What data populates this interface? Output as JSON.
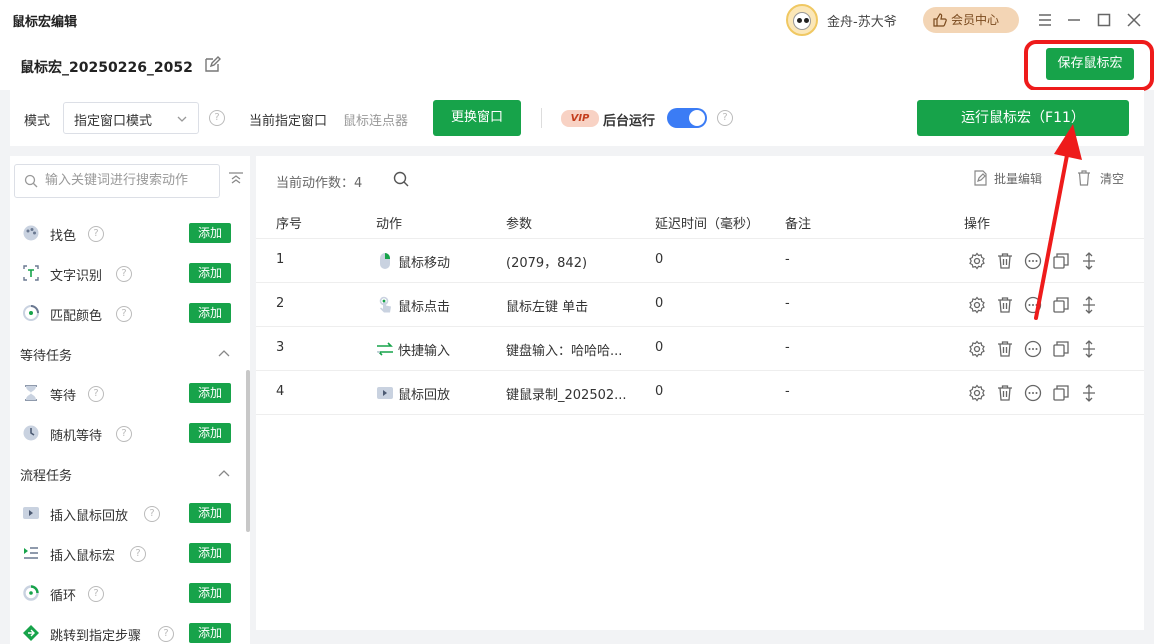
{
  "window": {
    "title": "鼠标宏编辑",
    "user_name": "金舟-苏大爷",
    "member_center": "会员中心"
  },
  "header": {
    "macro_name": "鼠标宏_20250226_2052",
    "save_label": "保存鼠标宏"
  },
  "mode_bar": {
    "mode_label": "模式",
    "mode_value": "指定窗口模式",
    "current_window_label": "当前指定窗口",
    "current_window_value": "鼠标连点器",
    "change_window": "更换窗口",
    "vip": "VIP",
    "background_run": "后台运行",
    "background_run_on": true,
    "run_label": "运行鼠标宏（F11）"
  },
  "sidebar": {
    "search_placeholder": "输入关键词进行搜索动作",
    "add_label": "添加",
    "items_top": [
      {
        "label": "找色",
        "icon": "palette-icon"
      },
      {
        "label": "文字识别",
        "icon": "text-recognition-icon"
      },
      {
        "label": "匹配颜色",
        "icon": "color-match-icon"
      }
    ],
    "sections": [
      {
        "title": "等待任务",
        "items": [
          {
            "label": "等待",
            "icon": "hourglass-icon"
          },
          {
            "label": "随机等待",
            "icon": "clock-icon"
          }
        ]
      },
      {
        "title": "流程任务",
        "items": [
          {
            "label": "插入鼠标回放",
            "icon": "playback-icon"
          },
          {
            "label": "插入鼠标宏",
            "icon": "macro-list-icon"
          },
          {
            "label": "循环",
            "icon": "loop-icon"
          },
          {
            "label": "跳转到指定步骤",
            "icon": "jump-icon"
          }
        ]
      }
    ]
  },
  "main": {
    "count_label": "当前动作数：4",
    "batch_edit": "批量编辑",
    "clear": "清空",
    "columns": [
      "序号",
      "动作",
      "参数",
      "延迟时间（毫秒）",
      "备注",
      "操作"
    ],
    "rows": [
      {
        "index": "1",
        "action": "鼠标移动",
        "icon": "mouse-icon",
        "params": "(2079，842)",
        "delay": "0",
        "note": "-"
      },
      {
        "index": "2",
        "action": "鼠标点击",
        "icon": "click-icon",
        "params": "鼠标左键 单击",
        "delay": "0",
        "note": "-"
      },
      {
        "index": "3",
        "action": "快捷输入",
        "icon": "quick-input-icon",
        "params": "键盘输入：哈哈哈...",
        "delay": "0",
        "note": "-"
      },
      {
        "index": "4",
        "action": "鼠标回放",
        "icon": "playback-icon",
        "params": "键鼠录制_202502...",
        "delay": "0",
        "note": "-"
      }
    ]
  },
  "colors": {
    "primary_green": "#17a34a",
    "toggle_blue": "#3b7cf5",
    "annotation_red": "#ee1b1b"
  }
}
